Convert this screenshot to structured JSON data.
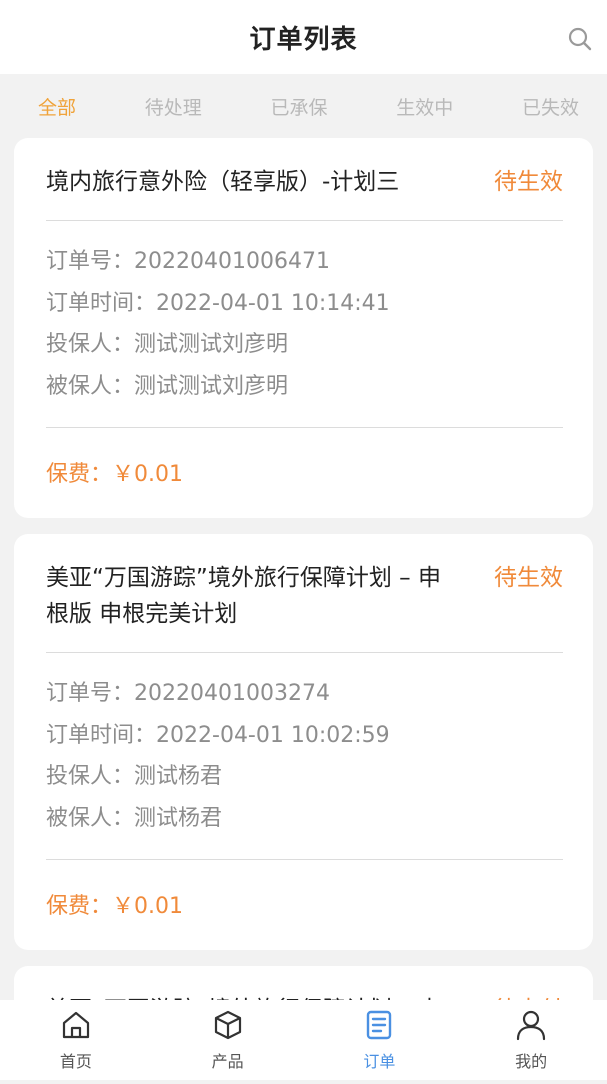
{
  "header": {
    "title": "订单列表",
    "search_icon": "search-icon"
  },
  "tabs": [
    {
      "label": "全部",
      "active": true
    },
    {
      "label": "待处理"
    },
    {
      "label": "已承保"
    },
    {
      "label": "生效中"
    },
    {
      "label": "已失效"
    }
  ],
  "orders": [
    {
      "title": "境内旅行意外险（轻享版）-计划三",
      "status": "待生效",
      "order_no_label": "订单号：",
      "order_no": "20220401006471",
      "order_time_label": "订单时间：",
      "order_time": "2022-04-01 10:14:41",
      "applicant_label": "投保人：",
      "applicant": "测试测试刘彦明",
      "insured_label": "被保人：",
      "insured": "测试测试刘彦明",
      "premium_label": "保费：",
      "premium": "￥0.01"
    },
    {
      "title": "美亚“万国游踪”境外旅行保障计划 – 申根版 申根完美计划",
      "status": "待生效",
      "order_no_label": "订单号：",
      "order_no": "20220401003274",
      "order_time_label": "订单时间：",
      "order_time": "2022-04-01 10:02:59",
      "applicant_label": "投保人：",
      "applicant": "测试杨君",
      "insured_label": "被保人：",
      "insured": "测试杨君",
      "premium_label": "保费：",
      "premium": "￥0.01"
    },
    {
      "title": "美亚“万国游踪”境外旅行保障计划 – 申",
      "status": "待支付"
    }
  ],
  "bottom_nav": [
    {
      "label": "首页",
      "icon": "home-icon"
    },
    {
      "label": "产品",
      "icon": "cube-icon"
    },
    {
      "label": "订单",
      "icon": "order-list-icon",
      "active": true
    },
    {
      "label": "我的",
      "icon": "user-icon"
    }
  ],
  "colors": {
    "accent_tab": "#f0a33a",
    "status_orange": "#f08a3a",
    "nav_active": "#4a90e2"
  }
}
